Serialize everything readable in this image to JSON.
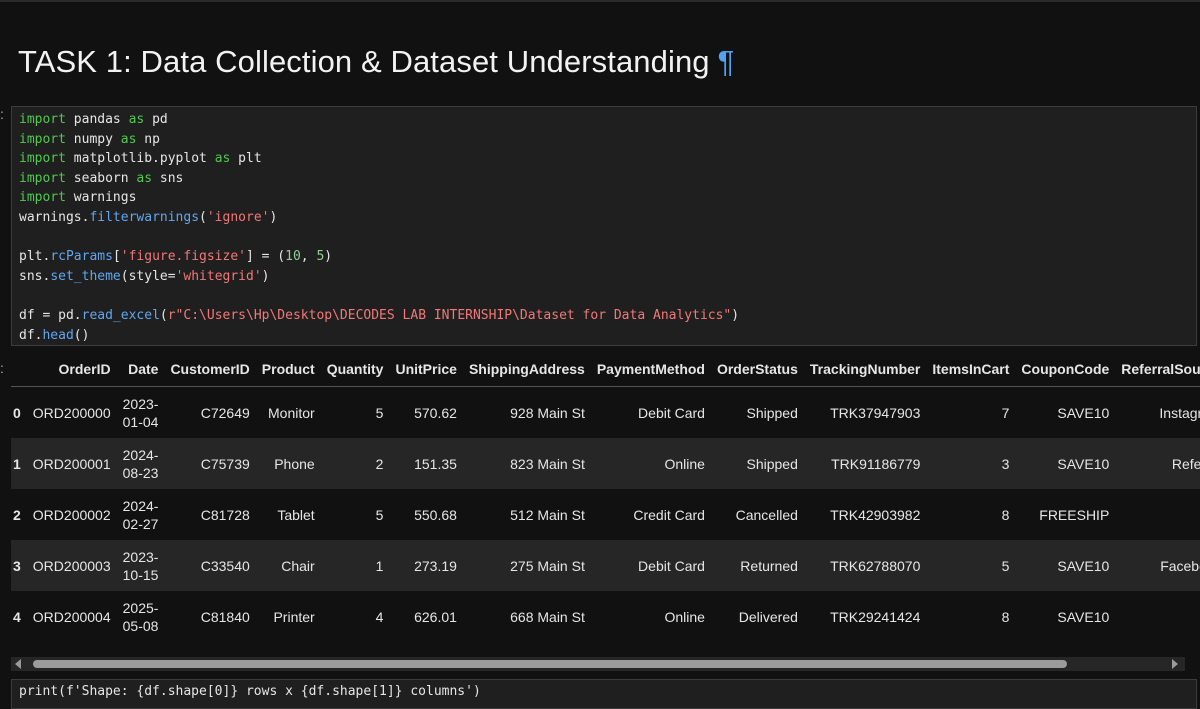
{
  "heading": {
    "title": "TASK 1: Data Collection & Dataset Understanding",
    "anchor": "¶"
  },
  "code_cell": {
    "lines": [
      [
        {
          "t": "import",
          "c": "kw"
        },
        {
          "t": " pandas "
        },
        {
          "t": "as",
          "c": "kw"
        },
        {
          "t": " pd"
        }
      ],
      [
        {
          "t": "import",
          "c": "kw"
        },
        {
          "t": " numpy "
        },
        {
          "t": "as",
          "c": "kw"
        },
        {
          "t": " np"
        }
      ],
      [
        {
          "t": "import",
          "c": "kw"
        },
        {
          "t": " matplotlib.pyplot "
        },
        {
          "t": "as",
          "c": "kw"
        },
        {
          "t": " plt"
        }
      ],
      [
        {
          "t": "import",
          "c": "kw"
        },
        {
          "t": " seaborn "
        },
        {
          "t": "as",
          "c": "kw"
        },
        {
          "t": " sns"
        }
      ],
      [
        {
          "t": "import",
          "c": "kw"
        },
        {
          "t": " warnings"
        }
      ],
      [
        {
          "t": "warnings."
        },
        {
          "t": "filterwarnings",
          "c": "fn"
        },
        {
          "t": "("
        },
        {
          "t": "'ignore'",
          "c": "str"
        },
        {
          "t": ")"
        }
      ],
      [],
      [
        {
          "t": "plt."
        },
        {
          "t": "rcParams",
          "c": "fn"
        },
        {
          "t": "["
        },
        {
          "t": "'figure.figsize'",
          "c": "str"
        },
        {
          "t": "] = ("
        },
        {
          "t": "10",
          "c": "num"
        },
        {
          "t": ", "
        },
        {
          "t": "5",
          "c": "num"
        },
        {
          "t": ")"
        }
      ],
      [
        {
          "t": "sns."
        },
        {
          "t": "set_theme",
          "c": "fn"
        },
        {
          "t": "(style="
        },
        {
          "t": "'whitegrid'",
          "c": "str"
        },
        {
          "t": ")"
        }
      ],
      [],
      [
        {
          "t": "df = pd."
        },
        {
          "t": "read_excel",
          "c": "fn"
        },
        {
          "t": "("
        },
        {
          "t": "r\"C:\\Users\\Hp\\Desktop\\DECODES LAB INTERNSHIP\\Dataset for Data Analytics\"",
          "c": "str"
        },
        {
          "t": ")"
        }
      ],
      [
        {
          "t": "df."
        },
        {
          "t": "head",
          "c": "fn"
        },
        {
          "t": "()"
        }
      ]
    ]
  },
  "output_table": {
    "columns": [
      "",
      "OrderID",
      "Date",
      "CustomerID",
      "Product",
      "Quantity",
      "UnitPrice",
      "ShippingAddress",
      "PaymentMethod",
      "OrderStatus",
      "TrackingNumber",
      "ItemsInCart",
      "CouponCode",
      "ReferralSource"
    ],
    "rows": [
      [
        "0",
        "ORD200000",
        [
          "2023-",
          "01-04"
        ],
        "C72649",
        "Monitor",
        "5",
        "570.62",
        "928 Main St",
        "Debit Card",
        "Shipped",
        "TRK37947903",
        "7",
        "SAVE10",
        "Instagram"
      ],
      [
        "1",
        "ORD200001",
        [
          "2024-",
          "08-23"
        ],
        "C75739",
        "Phone",
        "2",
        "151.35",
        "823 Main St",
        "Online",
        "Shipped",
        "TRK91186779",
        "3",
        "SAVE10",
        "Referral"
      ],
      [
        "2",
        "ORD200002",
        [
          "2024-",
          "02-27"
        ],
        "C81728",
        "Tablet",
        "5",
        "550.68",
        "512 Main St",
        "Credit Card",
        "Cancelled",
        "TRK42903982",
        "8",
        "FREESHIP",
        ""
      ],
      [
        "3",
        "ORD200003",
        [
          "2023-",
          "10-15"
        ],
        "C33540",
        "Chair",
        "1",
        "273.19",
        "275 Main St",
        "Debit Card",
        "Returned",
        "TRK62788070",
        "5",
        "SAVE10",
        "Facebook"
      ],
      [
        "4",
        "ORD200004",
        [
          "2025-",
          "05-08"
        ],
        "C81840",
        "Printer",
        "4",
        "626.01",
        "668 Main St",
        "Online",
        "Delivered",
        "TRK29241424",
        "8",
        "SAVE10",
        ""
      ]
    ]
  },
  "next_cell": {
    "text": "print(f'Shape: {df.shape[0]} rows x {df.shape[1]} columns')"
  },
  "icons": {
    "scroll_left": "scroll-left-arrow-icon",
    "scroll_right": "scroll-right-arrow-icon"
  }
}
